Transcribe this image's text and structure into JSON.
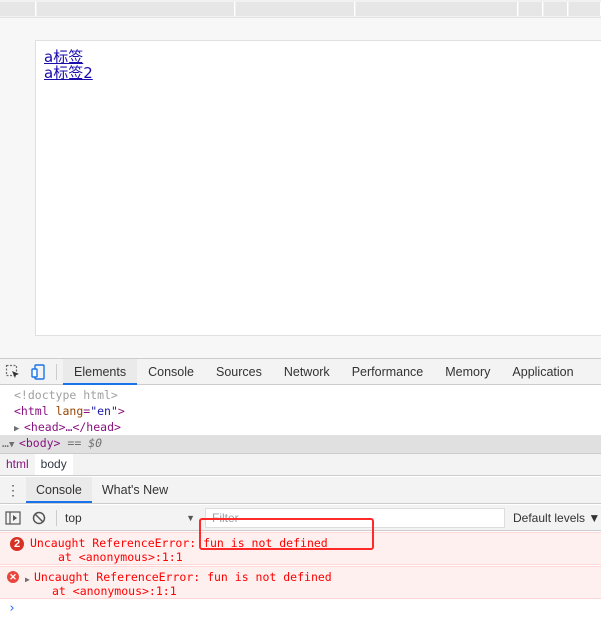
{
  "viewport": {
    "links": [
      "a标签",
      "a标签2"
    ]
  },
  "devtools": {
    "tabs": [
      "Elements",
      "Console",
      "Sources",
      "Network",
      "Performance",
      "Memory",
      "Application"
    ],
    "active_tab": "Elements",
    "elements": {
      "doctype": "<!doctype html>",
      "html_open": "<html",
      "html_attr": "lang",
      "html_val": "\"en\"",
      "html_close": ">",
      "head": "<head>…</head>",
      "body_tag": "<body>",
      "body_eq": "== $0",
      "ellipsis": "…"
    },
    "breadcrumbs": [
      "html",
      "body"
    ],
    "drawer_tabs": [
      "Console",
      "What's New"
    ],
    "console_toolbar": {
      "context": "top",
      "filter_placeholder": "Filter",
      "levels": "Default levels ▼"
    },
    "messages": [
      {
        "count": "2",
        "text": "Uncaught ReferenceError: fun is not defined",
        "stack": "at <anonymous>:1:1"
      },
      {
        "text": "Uncaught ReferenceError: fun is not defined",
        "stack": "at <anonymous>:1:1"
      }
    ],
    "prompt": "›"
  },
  "colors": {
    "accent": "#1a73e8",
    "error": "#ff0000",
    "highlight_box": "#ff2a2a"
  }
}
